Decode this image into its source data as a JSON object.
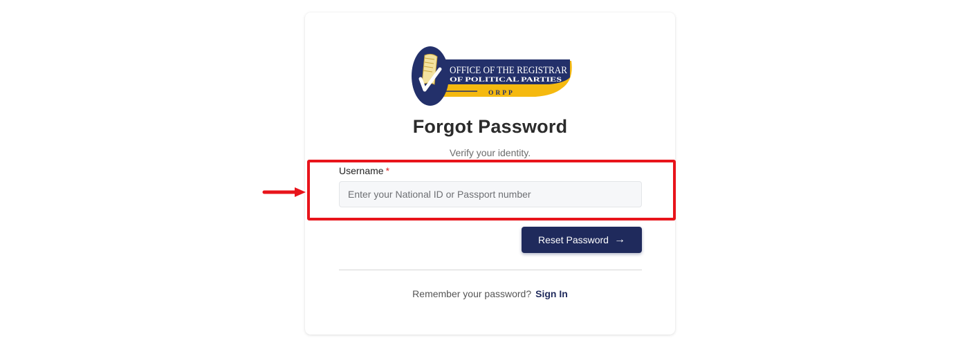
{
  "logo": {
    "line1": "OFFICE OF THE REGISTRAR",
    "line2": "OF POLITICAL PARTIES",
    "abbr": "ORPP",
    "colors": {
      "navy": "#23306a",
      "gold": "#f5b90f",
      "cream": "#f3e2a0"
    }
  },
  "page": {
    "title": "Forgot Password",
    "subtitle": "Verify your identity."
  },
  "form": {
    "username_label": "Username",
    "required_mark": "*",
    "username_placeholder": "Enter your National ID or Passport number",
    "username_value": ""
  },
  "actions": {
    "reset_label": "Reset Password",
    "reset_icon": "arrow-right-icon"
  },
  "footer": {
    "prompt": "Remember your password?",
    "signin_label": "Sign In"
  },
  "annotation": {
    "highlight_color": "#e8141b",
    "pointer_icon": "red-arrow-icon"
  }
}
